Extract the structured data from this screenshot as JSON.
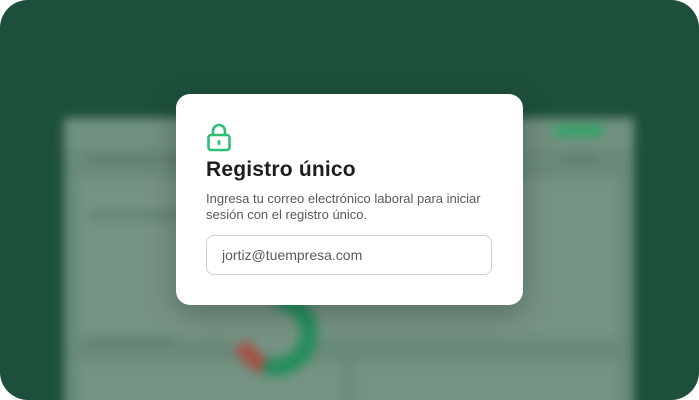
{
  "modal": {
    "icon": "lock-icon",
    "title": "Registro único",
    "description": "Ingresa tu correo electrónico laboral para iniciar sesión con el registro único.",
    "email_placeholder": "jortiz@tuempresa.com"
  },
  "colors": {
    "background": "#1f5540",
    "accent": "#2fbf73",
    "card": "#ffffff"
  }
}
